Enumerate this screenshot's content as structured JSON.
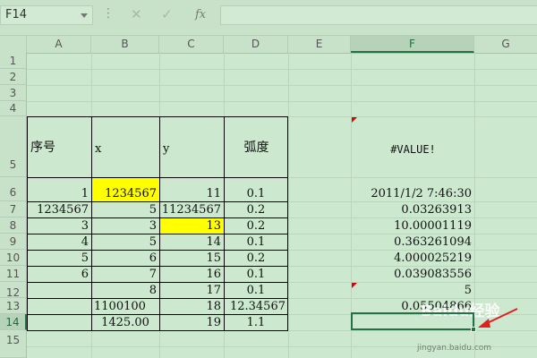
{
  "formula_bar": {
    "name_box": "F14",
    "formula": "",
    "fx_label": "fx",
    "cancel_glyph": "✕",
    "enter_glyph": "✓",
    "more_glyph": "⋮"
  },
  "columns": [
    "A",
    "B",
    "C",
    "D",
    "E",
    "F",
    "G"
  ],
  "selected_column": "F",
  "rows": [
    "1",
    "2",
    "3",
    "4",
    "5",
    "6",
    "7",
    "8",
    "9",
    "10",
    "11",
    "12",
    "13",
    "14",
    "15"
  ],
  "selected_row": "14",
  "headers": {
    "seq": "序号",
    "x": "x",
    "y": "y",
    "radian": "弧度",
    "f5": "#VALUE!"
  },
  "table": [
    {
      "a": "1",
      "b": "1234567",
      "c": "11",
      "d": "0.1",
      "f": "2011/1/2 7:46:30"
    },
    {
      "a": "1234567",
      "b": "5",
      "c": "11234567",
      "d": "0.2",
      "f": "0.03263913"
    },
    {
      "a": "3",
      "b": "3",
      "c": "13",
      "d": "0.2",
      "f": "10.00001119"
    },
    {
      "a": "4",
      "b": "5",
      "c": "14",
      "d": "0.1",
      "f": "0.363261094"
    },
    {
      "a": "5",
      "b": "6",
      "c": "15",
      "d": "0.2",
      "f": "4.000025219"
    },
    {
      "a": "6",
      "b": "7",
      "c": "16",
      "d": "0.1",
      "f": "0.039083556"
    },
    {
      "a": "",
      "b": "8",
      "c": "17",
      "d": "0.1",
      "f": "5"
    },
    {
      "a": "",
      "b": "1100100",
      "c": "18",
      "d": "12.34567",
      "f": "0.05504866"
    },
    {
      "a": "",
      "b": "1425.00",
      "c": "19",
      "d": "1.1",
      "f": ""
    }
  ],
  "watermark": {
    "brand": "Baidu经验",
    "url": "jingyan.baidu.com"
  },
  "colors": {
    "background": "#cce8cf",
    "highlight": "#ffff00",
    "selection": "#217346",
    "error_marker": "#e00000"
  }
}
